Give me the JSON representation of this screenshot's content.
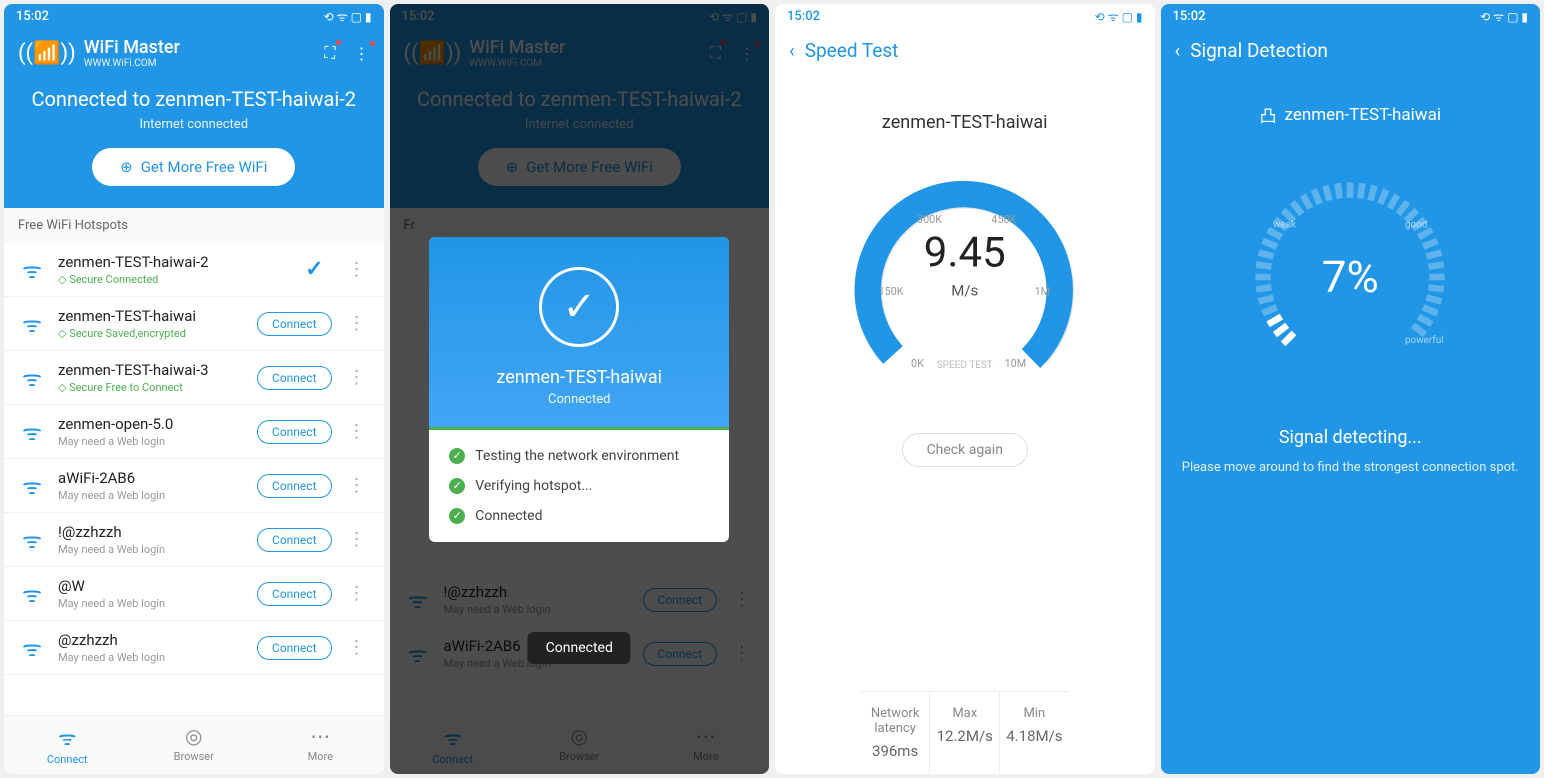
{
  "status_time": "15:02",
  "status_icons": "⟲ ᯤ ▢ ▮",
  "app_name": "WiFi Master",
  "app_url": "WWW.WiFi.COM",
  "screen1": {
    "banner_title": "Connected to zenmen-TEST-haiwai-2",
    "banner_sub": "Internet connected",
    "get_more": "Get More Free WiFi",
    "section": "Free WiFi Hotspots",
    "list": [
      {
        "name": "zenmen-TEST-haiwai-2",
        "meta": "Secure   Connected",
        "secure": true,
        "action": "check"
      },
      {
        "name": "zenmen-TEST-haiwai",
        "meta": "Secure   Saved,encrypted",
        "secure": true,
        "action": "connect"
      },
      {
        "name": "zenmen-TEST-haiwai-3",
        "meta": "Secure   Free to Connect",
        "secure": true,
        "action": "connect"
      },
      {
        "name": "zenmen-open-5.0",
        "meta": "May need a Web login",
        "secure": false,
        "action": "connect"
      },
      {
        "name": "aWiFi-2AB6",
        "meta": "May need a Web login",
        "secure": false,
        "action": "connect"
      },
      {
        "name": "!@zzhzzh",
        "meta": "May need a Web login",
        "secure": false,
        "action": "connect"
      },
      {
        "name": "@W",
        "meta": "May need a Web login",
        "secure": false,
        "action": "connect"
      },
      {
        "name": "@zzhzzh",
        "meta": "May need a Web login",
        "secure": false,
        "action": "connect"
      }
    ],
    "connect_label": "Connect"
  },
  "screen2": {
    "modal_name": "zenmen-TEST-haiwai",
    "modal_status": "Connected",
    "steps": [
      "Testing the network environment",
      "Verifying hotspot...",
      "Connected"
    ],
    "toast": "Connected",
    "bg_list": [
      {
        "name": "!@zzhzzh",
        "meta": "May need a Web login"
      },
      {
        "name": "aWiFi-2AB6",
        "meta": "May need a Web login"
      }
    ],
    "section_prefix": "Fr"
  },
  "nav": {
    "connect": "Connect",
    "browser": "Browser",
    "more": "More"
  },
  "screen3": {
    "title": "Speed Test",
    "ssid": "zenmen-TEST-haiwai",
    "value": "9.45",
    "unit": "M/s",
    "label": "SPEED TEST",
    "ticks": [
      "0K",
      "150K",
      "300K",
      "450K",
      "1M",
      "10M"
    ],
    "check_again": "Check again",
    "stats": [
      {
        "label": "Network latency",
        "val": "396ms"
      },
      {
        "label": "Max",
        "val": "12.2M/s"
      },
      {
        "label": "Min",
        "val": "4.18M/s"
      }
    ]
  },
  "screen4": {
    "title": "Signal Detection",
    "ssid": "zenmen-TEST-haiwai",
    "pct": "7%",
    "labels": {
      "weak": "weak",
      "good": "good",
      "powerful": "powerful"
    },
    "status": "Signal detecting...",
    "hint": "Please move around to find the strongest connection spot."
  }
}
